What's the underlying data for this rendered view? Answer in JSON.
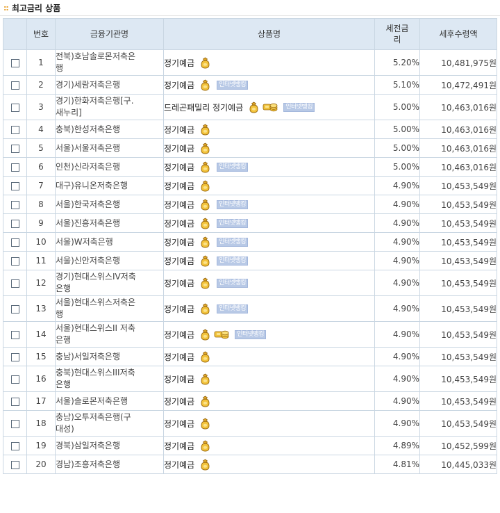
{
  "section": {
    "title": "최고금리 상품",
    "bullet": "::"
  },
  "columns": {
    "no": "번호",
    "institution": "금융기관명",
    "product": "상품명",
    "rate_line1": "세전금",
    "rate_line2": "리",
    "amount": "세후수령액"
  },
  "badge_text": "인터넷뱅킹",
  "icons": {
    "money_bag": "money-bag-icon",
    "coins": "coins-icon",
    "checkbox": "checkbox"
  },
  "colors": {
    "header_bg": "#dde8f3",
    "border": "#c9d6e2",
    "badge": "#b8c9e6",
    "bullet": "#e8a02a"
  },
  "rows": [
    {
      "no": "1",
      "inst": [
        "전북)호남솔로몬저축은",
        "행"
      ],
      "product": "정기예금",
      "coins": false,
      "net": false,
      "rate": "5.20%",
      "amount": "10,481,975원"
    },
    {
      "no": "2",
      "inst": [
        "경기)세람저축은행"
      ],
      "product": "정기예금",
      "coins": false,
      "net": true,
      "rate": "5.10%",
      "amount": "10,472,491원"
    },
    {
      "no": "3",
      "inst": [
        "경기)한화저축은행[구.",
        "새누리]"
      ],
      "product": "드레곤패밀리 정기예금",
      "coins": true,
      "net": true,
      "rate": "5.00%",
      "amount": "10,463,016원"
    },
    {
      "no": "4",
      "inst": [
        "충북)한성저축은행"
      ],
      "product": "정기예금",
      "coins": false,
      "net": false,
      "rate": "5.00%",
      "amount": "10,463,016원"
    },
    {
      "no": "5",
      "inst": [
        "서울)서울저축은행"
      ],
      "product": "정기예금",
      "coins": false,
      "net": false,
      "rate": "5.00%",
      "amount": "10,463,016원"
    },
    {
      "no": "6",
      "inst": [
        "인천)신라저축은행"
      ],
      "product": "정기예금",
      "coins": false,
      "net": true,
      "rate": "5.00%",
      "amount": "10,463,016원"
    },
    {
      "no": "7",
      "inst": [
        "대구)유니온저축은행"
      ],
      "product": "정기예금",
      "coins": false,
      "net": false,
      "rate": "4.90%",
      "amount": "10,453,549원"
    },
    {
      "no": "8",
      "inst": [
        "서울)한국저축은행"
      ],
      "product": "정기예금",
      "coins": false,
      "net": true,
      "rate": "4.90%",
      "amount": "10,453,549원"
    },
    {
      "no": "9",
      "inst": [
        "서울)진흥저축은행"
      ],
      "product": "정기예금",
      "coins": false,
      "net": true,
      "rate": "4.90%",
      "amount": "10,453,549원"
    },
    {
      "no": "10",
      "inst": [
        "서울)W저축은행"
      ],
      "product": "정기예금",
      "coins": false,
      "net": true,
      "rate": "4.90%",
      "amount": "10,453,549원"
    },
    {
      "no": "11",
      "inst": [
        "서울)신안저축은행"
      ],
      "product": "정기예금",
      "coins": false,
      "net": true,
      "rate": "4.90%",
      "amount": "10,453,549원"
    },
    {
      "no": "12",
      "inst": [
        "경기)현대스위스IV저축",
        "은행"
      ],
      "product": "정기예금",
      "coins": false,
      "net": true,
      "rate": "4.90%",
      "amount": "10,453,549원"
    },
    {
      "no": "13",
      "inst": [
        "서울)현대스위스저축은",
        "행"
      ],
      "product": "정기예금",
      "coins": false,
      "net": true,
      "rate": "4.90%",
      "amount": "10,453,549원"
    },
    {
      "no": "14",
      "inst": [
        "서울)현대스위스II 저축",
        "은행"
      ],
      "product": "정기예금",
      "coins": true,
      "net": true,
      "rate": "4.90%",
      "amount": "10,453,549원"
    },
    {
      "no": "15",
      "inst": [
        "충남)서일저축은행"
      ],
      "product": "정기예금",
      "coins": false,
      "net": false,
      "rate": "4.90%",
      "amount": "10,453,549원"
    },
    {
      "no": "16",
      "inst": [
        "충북)현대스위스III저축",
        "은행"
      ],
      "product": "정기예금",
      "coins": false,
      "net": false,
      "rate": "4.90%",
      "amount": "10,453,549원"
    },
    {
      "no": "17",
      "inst": [
        "서울)솔로몬저축은행"
      ],
      "product": "정기예금",
      "coins": false,
      "net": false,
      "rate": "4.90%",
      "amount": "10,453,549원"
    },
    {
      "no": "18",
      "inst": [
        "충남)오투저축은행(구",
        "대성)"
      ],
      "product": "정기예금",
      "coins": false,
      "net": false,
      "rate": "4.90%",
      "amount": "10,453,549원"
    },
    {
      "no": "19",
      "inst": [
        "경북)삼일저축은행"
      ],
      "product": "정기예금",
      "coins": false,
      "net": false,
      "rate": "4.89%",
      "amount": "10,452,599원"
    },
    {
      "no": "20",
      "inst": [
        "경남)조흥저축은행"
      ],
      "product": "정기예금",
      "coins": false,
      "net": false,
      "rate": "4.81%",
      "amount": "10,445,033원"
    }
  ]
}
